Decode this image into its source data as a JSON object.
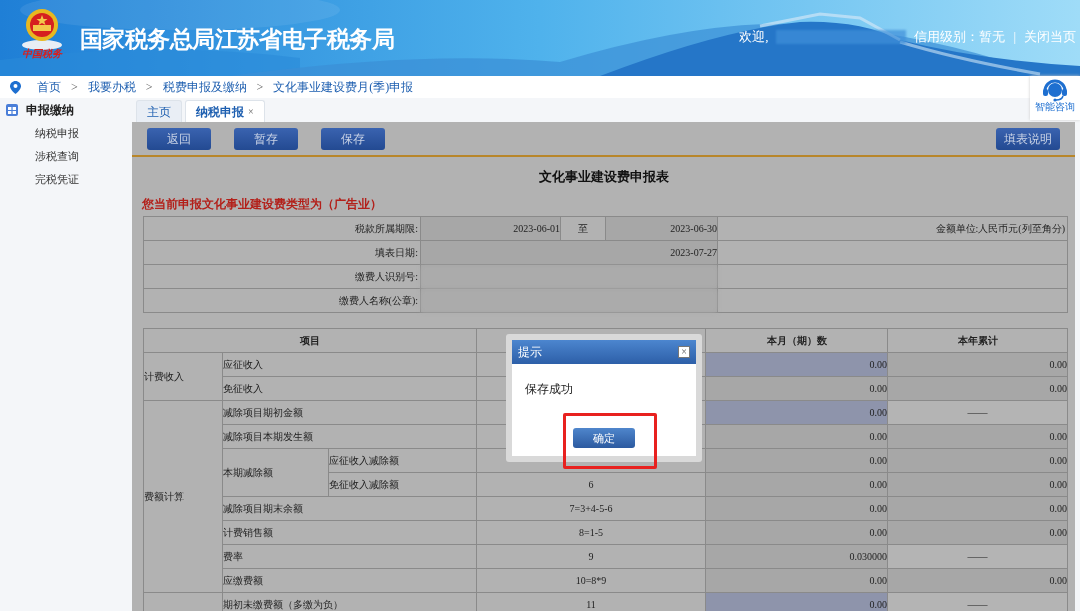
{
  "header": {
    "title": "国家税务总局江苏省电子税务局",
    "logo_text": "中国税务",
    "welcome": "欢迎,",
    "credit": "信用级别：暂无",
    "separator": "|",
    "close_page": "关闭当页"
  },
  "breadcrumb": [
    "首页",
    "我要办税",
    "税费申报及缴纳",
    "文化事业建设费月(季)申报"
  ],
  "breadcrumb_separator": ">",
  "help": {
    "label": "智能咨询"
  },
  "sidebar": {
    "title": "申报缴纳",
    "items": [
      "纳税申报",
      "涉税查询",
      "完税凭证"
    ]
  },
  "tabs": [
    {
      "label": "主页",
      "selected": false,
      "closable": false
    },
    {
      "label": "纳税申报",
      "selected": true,
      "closable": true,
      "close": "×"
    }
  ],
  "toolbar": {
    "buttons": [
      "返回",
      "暂存",
      "保存"
    ],
    "help_button": "填表说明"
  },
  "form": {
    "title": "文化事业建设费申报表",
    "notice": "您当前申报文化事业建设费类型为（广告业）",
    "info": [
      [
        {
          "text": "税款所属期限:",
          "kind": "label"
        },
        {
          "text": "2023-06-01",
          "kind": "value"
        },
        {
          "text": "至",
          "kind": "center"
        },
        {
          "text": "2023-06-30",
          "kind": "value"
        },
        {
          "text": "金额单位:人民币元(列至角分)",
          "kind": "label"
        }
      ],
      [
        {
          "text": "填表日期:",
          "kind": "label"
        },
        {
          "text": "2023-07-27",
          "kind": "value",
          "colspan": 3
        },
        {
          "kind": "blank"
        }
      ],
      [
        {
          "text": "缴费人识别号:",
          "kind": "label"
        },
        {
          "kind": "redacted",
          "colspan": 3
        },
        {
          "kind": "blank"
        }
      ],
      [
        {
          "text": "缴费人名称(公章):",
          "kind": "label"
        },
        {
          "kind": "redacted",
          "colspan": 3
        },
        {
          "kind": "blank"
        }
      ]
    ],
    "table": [
      [
        {
          "text": "项目",
          "kind": "header",
          "colspan": 3
        },
        {
          "kind": "header"
        },
        {
          "text": "本月（期）数",
          "kind": "header"
        },
        {
          "text": "本年累计",
          "kind": "header"
        }
      ],
      [
        {
          "text": "计费收入",
          "kind": "label",
          "rowspan": 2
        },
        {
          "text": "应征收入",
          "kind": "label",
          "colspan": 2
        },
        {
          "kind": "formula"
        },
        {
          "text": "0.00",
          "kind": "input"
        },
        {
          "text": "0.00",
          "kind": "calc"
        }
      ],
      [
        {
          "text": "免征收入",
          "kind": "label",
          "colspan": 2
        },
        {
          "kind": "formula"
        },
        {
          "text": "0.00",
          "kind": "calc"
        },
        {
          "text": "0.00",
          "kind": "calc"
        }
      ],
      [
        {
          "text": "费额计算",
          "kind": "label",
          "rowspan": 8
        },
        {
          "text": "减除项目期初金额",
          "kind": "label",
          "colspan": 2
        },
        {
          "kind": "formula"
        },
        {
          "text": "0.00",
          "kind": "input"
        },
        {
          "text": "——",
          "kind": "na"
        }
      ],
      [
        {
          "text": "减除项目本期发生额",
          "kind": "label",
          "colspan": 2
        },
        {
          "kind": "formula"
        },
        {
          "text": "0.00",
          "kind": "calc"
        },
        {
          "text": "0.00",
          "kind": "calc"
        }
      ],
      [
        {
          "text": "本期减除额",
          "kind": "label",
          "rowspan": 2
        },
        {
          "text": "应征收入减除额",
          "kind": "label"
        },
        {
          "kind": "formula"
        },
        {
          "text": "0.00",
          "kind": "calc"
        },
        {
          "text": "0.00",
          "kind": "calc"
        }
      ],
      [
        {
          "text": "免征收入减除额",
          "kind": "label"
        },
        {
          "text": "6",
          "kind": "formula"
        },
        {
          "text": "0.00",
          "kind": "calc"
        },
        {
          "text": "0.00",
          "kind": "calc"
        }
      ],
      [
        {
          "text": "减除项目期末余额",
          "kind": "label",
          "colspan": 2
        },
        {
          "text": "7=3+4-5-6",
          "kind": "formula"
        },
        {
          "text": "0.00",
          "kind": "calc"
        },
        {
          "text": "0.00",
          "kind": "calc"
        }
      ],
      [
        {
          "text": "计费销售额",
          "kind": "label",
          "colspan": 2
        },
        {
          "text": "8=1-5",
          "kind": "formula"
        },
        {
          "text": "0.00",
          "kind": "calc"
        },
        {
          "text": "0.00",
          "kind": "calc"
        }
      ],
      [
        {
          "text": "费率",
          "kind": "label",
          "colspan": 2
        },
        {
          "text": "9",
          "kind": "formula"
        },
        {
          "text": "0.030000",
          "kind": "calc"
        },
        {
          "text": "——",
          "kind": "na"
        }
      ],
      [
        {
          "text": "应缴费额",
          "kind": "label",
          "colspan": 2
        },
        {
          "text": "10=8*9",
          "kind": "formula"
        },
        {
          "text": "0.00",
          "kind": "calc"
        },
        {
          "text": "0.00",
          "kind": "calc"
        }
      ],
      [
        {
          "kind": "label"
        },
        {
          "text": "期初未缴费额（多缴为负）",
          "kind": "label",
          "colspan": 2
        },
        {
          "text": "11",
          "kind": "formula"
        },
        {
          "text": "0.00",
          "kind": "input"
        },
        {
          "text": "——",
          "kind": "na"
        }
      ]
    ]
  },
  "dialog": {
    "title": "提示",
    "close": "×",
    "message": "保存成功",
    "button": "确定",
    "highlighted": true
  }
}
